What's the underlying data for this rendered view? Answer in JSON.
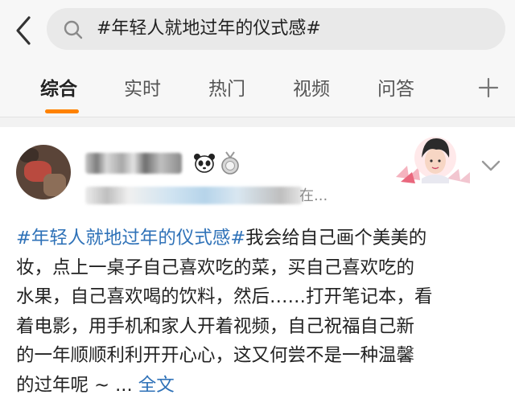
{
  "search": {
    "query": "#年轻人就地过年的仪式感#"
  },
  "tabs": [
    {
      "label": "综合",
      "active": true
    },
    {
      "label": "实时",
      "active": false
    },
    {
      "label": "热门",
      "active": false
    },
    {
      "label": "视频",
      "active": false
    },
    {
      "label": "问答",
      "active": false
    }
  ],
  "post": {
    "meta_tail": "在...",
    "body_lines": [
      {
        "hashtag": "#年轻人就地过年的仪式感#",
        "text": "我会给自己画个美美的"
      },
      {
        "text": "妆，点上一桌子自己喜欢吃的菜，买自己喜欢吃的"
      },
      {
        "text": "水果，自己喜欢喝的饮料，然后……打开笔记本，看"
      },
      {
        "text": "着电影，用手机和家人开着视频，自己祝福自己新"
      },
      {
        "text": "的一年顺顺利利开开心心，这又何尝不是一种温馨"
      },
      {
        "text": "的过年呢 ~ ...",
        "more": "全文"
      }
    ]
  },
  "colors": {
    "accent_orange": "#ff8200",
    "link_blue": "#2f72b8",
    "background": "#f2f2f2"
  },
  "icons": {
    "back": "chevron-left-icon",
    "search": "search-icon",
    "add": "plus-icon",
    "badge1": "panda-icon",
    "badge2": "medal-icon",
    "options": "chevron-down-icon"
  }
}
